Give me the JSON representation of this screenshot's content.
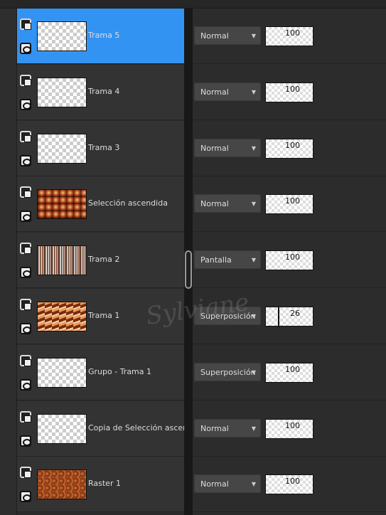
{
  "watermark": "Sylviane",
  "accent": "#3393f3",
  "layers": [
    {
      "name": "Trama 5",
      "blend": "Normal",
      "opacity": "100",
      "selected": true,
      "thumb": "none"
    },
    {
      "name": "Trama 4",
      "blend": "Normal",
      "opacity": "100",
      "thumb": "text"
    },
    {
      "name": "Trama 3",
      "blend": "Normal",
      "opacity": "100",
      "thumb": "speck"
    },
    {
      "name": "Selección ascendida",
      "blend": "Normal",
      "opacity": "100",
      "thumb": "photo"
    },
    {
      "name": "Trama 2",
      "blend": "Pantalla",
      "opacity": "100",
      "thumb": "stripes"
    },
    {
      "name": "Trama 1",
      "blend": "Superposición",
      "opacity": "26",
      "thumb": "full"
    },
    {
      "name": "Grupo - Trama 1",
      "blend": "Superposición",
      "opacity": "100",
      "thumb": "none"
    },
    {
      "name": "Copia de Selección ascendida",
      "blend": "Normal",
      "opacity": "100",
      "thumb": "bottom"
    },
    {
      "name": "Raster 1",
      "blend": "Normal",
      "opacity": "100",
      "thumb": "blur"
    }
  ]
}
